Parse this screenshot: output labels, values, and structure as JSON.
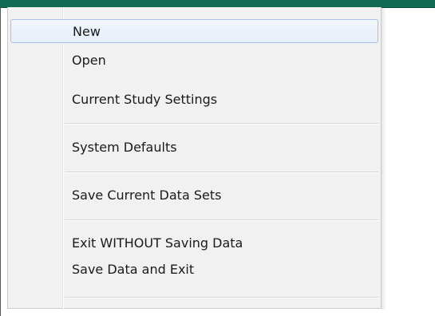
{
  "menu": {
    "items": [
      {
        "label": "New",
        "highlighted": true
      },
      {
        "label": "Open"
      },
      {
        "label": "Current Study Settings"
      },
      {
        "label": "System Defaults"
      },
      {
        "label": "Save Current Data Sets"
      },
      {
        "label": "Exit WITHOUT Saving Data"
      },
      {
        "label": "Save Data and Exit"
      }
    ]
  },
  "colors": {
    "menubar": "#0f6b53",
    "menu_background": "#f1f1f1",
    "highlight_border": "#a8c2e7",
    "highlight_fill": "#e5eefa"
  }
}
